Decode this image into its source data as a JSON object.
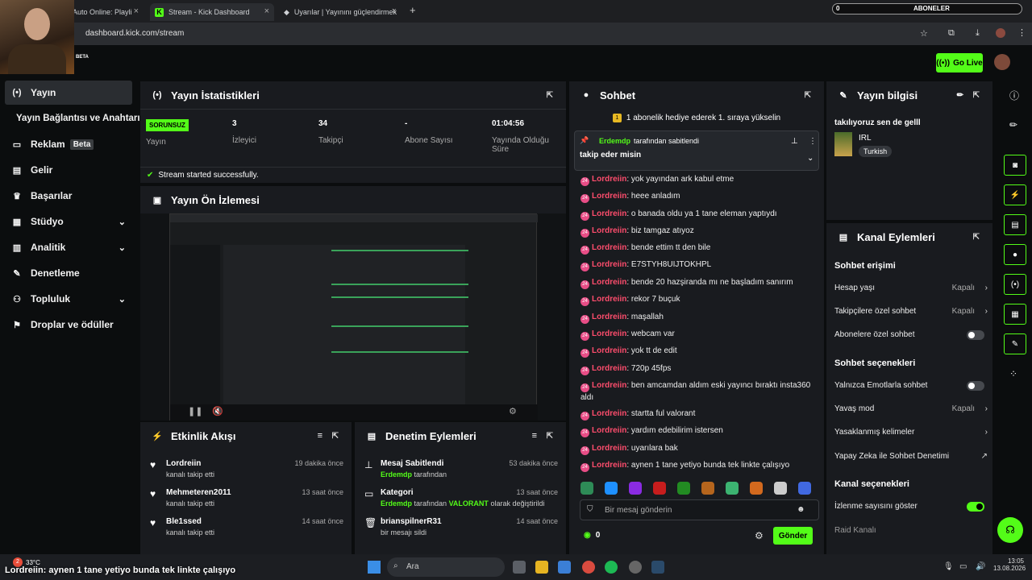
{
  "browser": {
    "tabs": [
      "Auto Online: Playli",
      "Stream - Kick Dashboard",
      "Uyarılar | Yayınını güçlendirmek"
    ],
    "url": "dashboard.kick.com/stream",
    "subs_label": "ABONELER",
    "subs_count": "0",
    "beta": "BETA"
  },
  "header": {
    "go_live": "Go Live"
  },
  "sidebar": {
    "items": [
      {
        "label": "Yayın",
        "icon": "broadcast-icon"
      },
      {
        "label": "Yayın Bağlantısı ve Anahtarı"
      },
      {
        "label": "Reklam",
        "badge": "Beta",
        "icon": "ad-icon"
      },
      {
        "label": "Gelir",
        "icon": "revenue-icon"
      },
      {
        "label": "Başarılar",
        "icon": "trophy-icon"
      },
      {
        "label": "Stüdyo",
        "icon": "studio-icon"
      },
      {
        "label": "Analitik",
        "icon": "analytics-icon"
      },
      {
        "label": "Denetleme",
        "icon": "wrench-icon"
      },
      {
        "label": "Topluluk",
        "icon": "community-icon"
      },
      {
        "label": "Droplar ve ödüller",
        "icon": "drops-icon"
      }
    ]
  },
  "stats": {
    "title": "Yayın İstatistikleri",
    "status_badge": "SORUNSUZ",
    "status_label": "Yayın",
    "viewers": "3",
    "viewers_label": "İzleyici",
    "followers": "34",
    "followers_label": "Takipçi",
    "subs": "-",
    "subs_label": "Abone Sayısı",
    "uptime": "01:04:56",
    "uptime_label": "Yayında Olduğu Süre",
    "success": "Stream started successfully."
  },
  "preview": {
    "title": "Yayın Ön İzlemesi"
  },
  "activity": {
    "title": "Etkinlik Akışı",
    "items": [
      {
        "name": "Lordreiin",
        "sub": "kanalı takip etti",
        "time": "19 dakika önce"
      },
      {
        "name": "Mehmeteren2011",
        "sub": "kanalı takip etti",
        "time": "13 saat önce"
      },
      {
        "name": "Ble1ssed",
        "sub": "kanalı takip etti",
        "time": "14 saat önce"
      }
    ]
  },
  "moderation": {
    "title": "Denetim Eylemleri",
    "items": [
      {
        "name": "Mesaj Sabitlendi",
        "user": "Erdemdp",
        "sub": "tarafından",
        "time": "53 dakika önce"
      },
      {
        "name": "Kategori",
        "user": "Erdemdp",
        "sub": "tarafından",
        "cat": "VALORANT",
        "sub2": "olarak değiştirildi",
        "time": "13 saat önce"
      },
      {
        "name": "brianspilnerR31",
        "sub": "bir mesajı sildi",
        "time": "14 saat önce"
      }
    ]
  },
  "chat": {
    "title": "Sohbet",
    "gift_banner": "1 abonelik hediye ederek 1. sıraya yükselin",
    "pinned_by": "Erdemdp",
    "pinned_label": "tarafından sabitlendi",
    "pinned_msg": "takip eder misin",
    "messages": [
      {
        "user": "Lordreiin",
        "text": ": yok yayından ark kabul etme"
      },
      {
        "user": "Lordreiin",
        "text": ": heee anladım"
      },
      {
        "user": "Lordreiin",
        "text": ": o banada oldu ya 1 tane eleman yaptıydı"
      },
      {
        "user": "Lordreiin",
        "text": ": biz tamgaz atıyoz"
      },
      {
        "user": "Lordreiin",
        "text": ": bende ettim tt den bile"
      },
      {
        "user": "Lordreiin",
        "text": ": E7STYH8UIJTOKHPL"
      },
      {
        "user": "Lordreiin",
        "text": ": bende 20 hazşiranda mı ne başladım sanırım"
      },
      {
        "user": "Lordreiin",
        "text": ": rekor 7 buçuk"
      },
      {
        "user": "Lordreiin",
        "text": ": maşallah"
      },
      {
        "user": "Lordreiin",
        "text": ": webcam var"
      },
      {
        "user": "Lordreiin",
        "text": ": yok tt de edit"
      },
      {
        "user": "Lordreiin",
        "text": ": 720p 45fps"
      },
      {
        "user": "Lordreiin",
        "text": ": ben amcamdan aldım eski yayıncı bıraktı insta360 aldı"
      },
      {
        "user": "Lordreiin",
        "text": ": startta ful valorant"
      },
      {
        "user": "Lordreiin",
        "text": ": yardım edebilirim istersen"
      },
      {
        "user": "Lordreiin",
        "text": ": uyarılara bak"
      },
      {
        "user": "Lordreiin",
        "text": ": aynen 1 tane yetiyo bunda tek linkte çalışıyo"
      }
    ],
    "input_placeholder": "Bir mesaj gönderin",
    "coins": "0",
    "send": "Gönder",
    "badge_num": "24"
  },
  "info": {
    "title": "Yayın bilgisi",
    "stream_title": "takılıyoruz sen de gelll",
    "category": "IRL",
    "tag": "Turkish"
  },
  "channel": {
    "title": "Kanal Eylemleri",
    "chat_access": "Sohbet erişimi",
    "account_age": "Hesap yaşı",
    "account_age_val": "Kapalı",
    "followers_only": "Takipçilere özel sohbet",
    "followers_only_val": "Kapalı",
    "subs_only": "Abonelere özel sohbet",
    "chat_options": "Sohbet seçenekleri",
    "emote_only": "Yalnızca Emotlarla sohbet",
    "slow_mode": "Yavaş mod",
    "slow_mode_val": "Kapalı",
    "banned_words": "Yasaklanmış kelimeler",
    "ai_mod": "Yapay Zeka ile Sohbet Denetimi",
    "channel_options": "Kanal seçenekleri",
    "show_views": "İzlenme sayısını göster",
    "raid": "Raid Kanalı"
  },
  "overlay": {
    "caption": "Lordreiin: aynen 1 tane yetiyo bunda tek linkte çalışıyo"
  },
  "taskbar": {
    "temp": "33°C",
    "search": "Ara",
    "time": "13:05",
    "date": "13.08.2026",
    "notif": "2"
  }
}
